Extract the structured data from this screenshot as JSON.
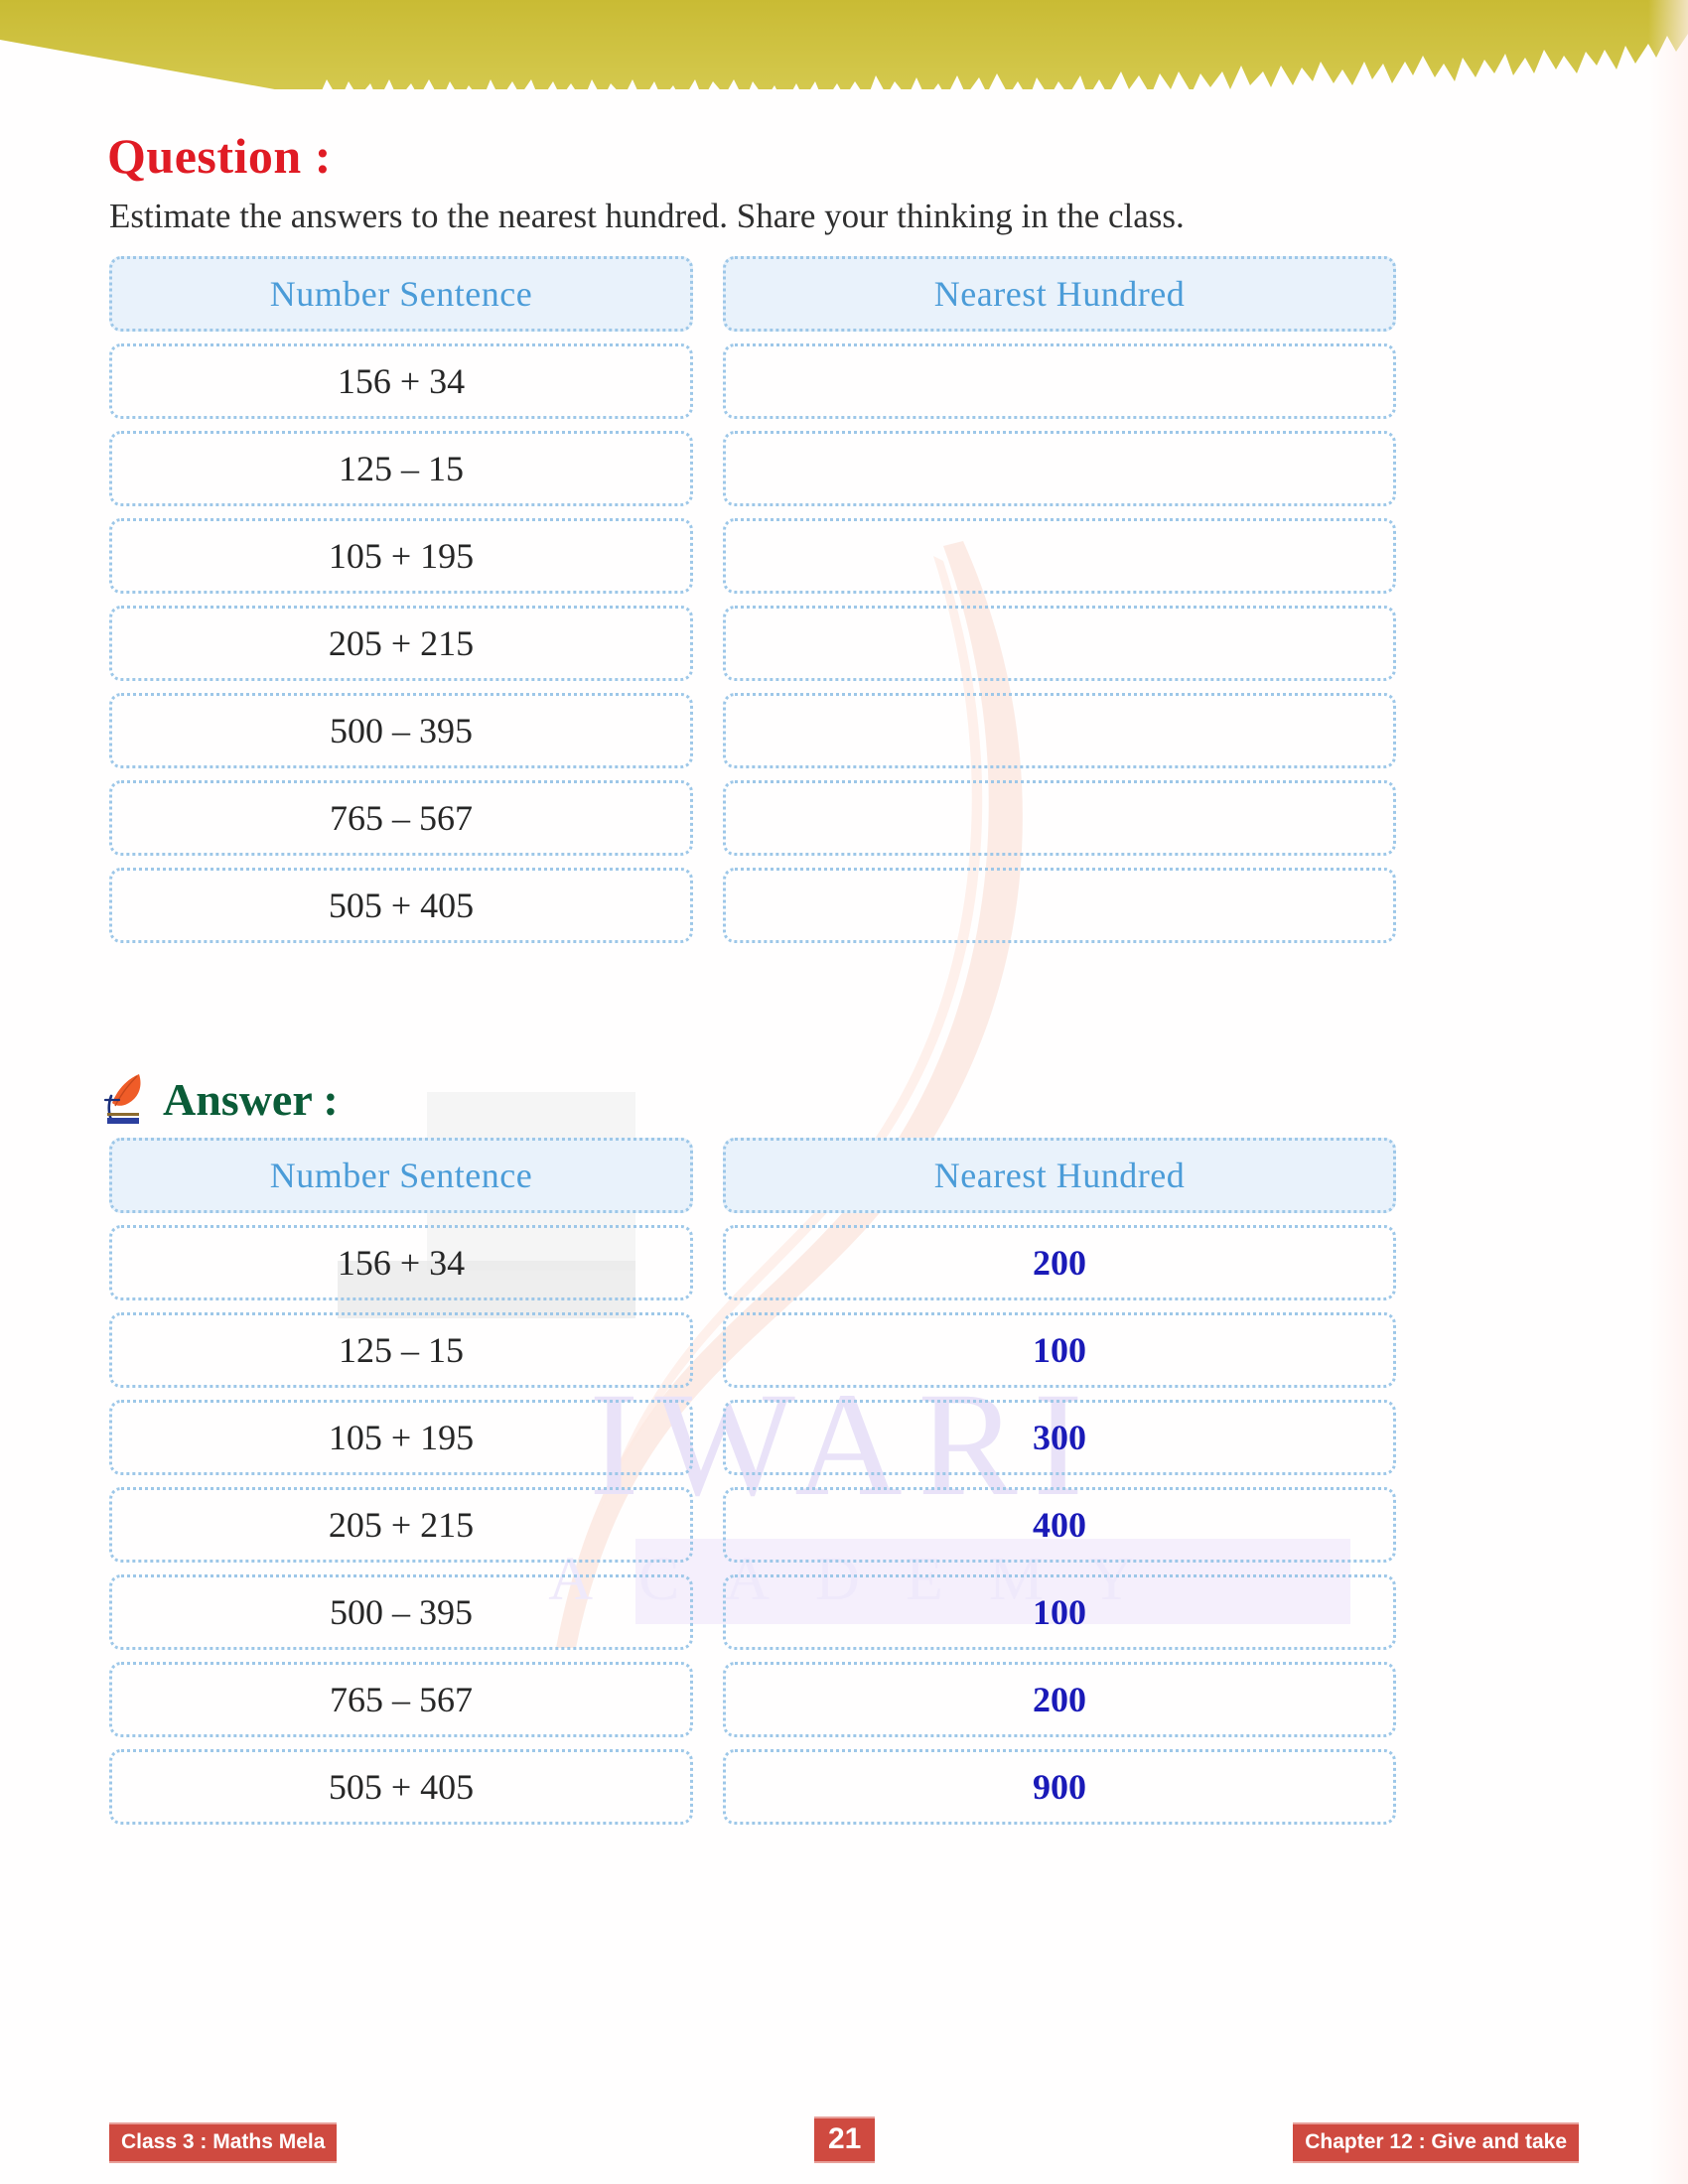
{
  "question": {
    "heading": "Question :",
    "instruction": "Estimate the answers to the nearest hundred. Share your thinking in the class."
  },
  "answer": {
    "heading": "Answer :",
    "logo_icon": "leaf-logo-icon"
  },
  "table_headers": {
    "col1": "Number Sentence",
    "col2": "Nearest Hundred"
  },
  "question_rows": [
    {
      "sentence": "156 + 34",
      "nearest": ""
    },
    {
      "sentence": "125 – 15",
      "nearest": ""
    },
    {
      "sentence": "105 + 195",
      "nearest": ""
    },
    {
      "sentence": "205 + 215",
      "nearest": ""
    },
    {
      "sentence": "500 – 395",
      "nearest": ""
    },
    {
      "sentence": "765 – 567",
      "nearest": ""
    },
    {
      "sentence": "505 + 405",
      "nearest": ""
    }
  ],
  "answer_rows": [
    {
      "sentence": "156 + 34",
      "nearest": "200"
    },
    {
      "sentence": "125 – 15",
      "nearest": "100"
    },
    {
      "sentence": "105 + 195",
      "nearest": "300"
    },
    {
      "sentence": "205 + 215",
      "nearest": "400"
    },
    {
      "sentence": "500 – 395",
      "nearest": "100"
    },
    {
      "sentence": "765 – 567",
      "nearest": "200"
    },
    {
      "sentence": "505 + 405",
      "nearest": "900"
    }
  ],
  "watermark": {
    "main": "IWARI",
    "sub": "ACADEMY"
  },
  "footer": {
    "left": "Class 3 : Maths Mela",
    "page": "21",
    "right": "Chapter 12 : Give and take"
  },
  "colors": {
    "question_heading": "#e01b24",
    "answer_heading": "#0b5c38",
    "table_header_text": "#4b9cd8",
    "table_header_bg": "#e9f2fb",
    "cell_border": "#9dc7e8",
    "answer_value": "#1a1ab8",
    "footer_badge": "#cf4a40",
    "top_edge": "#cbbe3d"
  }
}
